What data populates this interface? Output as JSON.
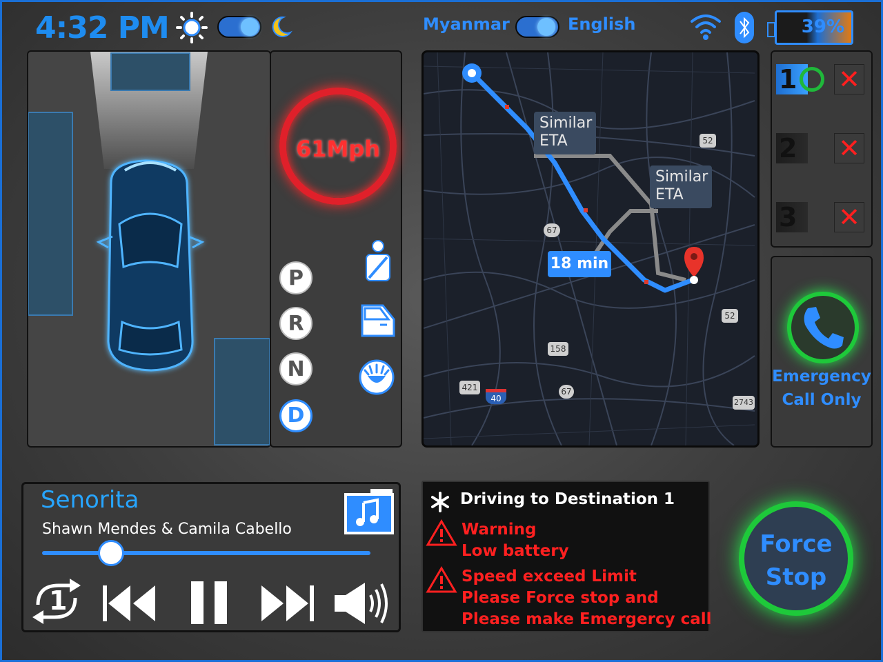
{
  "status_bar": {
    "time": "4:32 PM",
    "language_left": "Myanmar",
    "language_right": "English",
    "battery_percent": "39%",
    "icons": [
      "sun-icon",
      "moon-icon",
      "wifi-icon",
      "bluetooth-icon",
      "battery-icon"
    ]
  },
  "vehicle": {
    "speed": "61Mph",
    "gears": [
      "P",
      "R",
      "N",
      "D"
    ],
    "active_gear": "D",
    "status_icons": [
      "seatbelt-icon",
      "door-icon",
      "headlight-icon"
    ]
  },
  "map": {
    "route_labels": [
      "Similar ETA",
      "Similar ETA"
    ],
    "eta": "18 min",
    "road_markers": [
      "52",
      "67",
      "52",
      "158",
      "421",
      "40",
      "67",
      "2743"
    ]
  },
  "destinations": [
    {
      "number": "1",
      "active": true
    },
    {
      "number": "2",
      "active": false
    },
    {
      "number": "3",
      "active": false
    }
  ],
  "emergency": {
    "label_line1": "Emergency",
    "label_line2": "Call Only"
  },
  "media": {
    "title": "Senorita",
    "artist": "Shawn Mendes & Camila Cabello",
    "progress": 0.21,
    "repeat_count": "1"
  },
  "alerts": {
    "header": "Driving to Destination 1",
    "warning1": [
      "Warning",
      "Low battery"
    ],
    "warning2": [
      "Speed exceed Limit",
      "Please Force stop and",
      "Please make Emergercy call"
    ]
  },
  "force_stop": {
    "line1": "Force",
    "line2": "Stop"
  },
  "colors": {
    "accent": "#2f8dff",
    "alert": "#ff2020",
    "speed_ring": "#e0202a",
    "glow_green": "#22d13a"
  }
}
